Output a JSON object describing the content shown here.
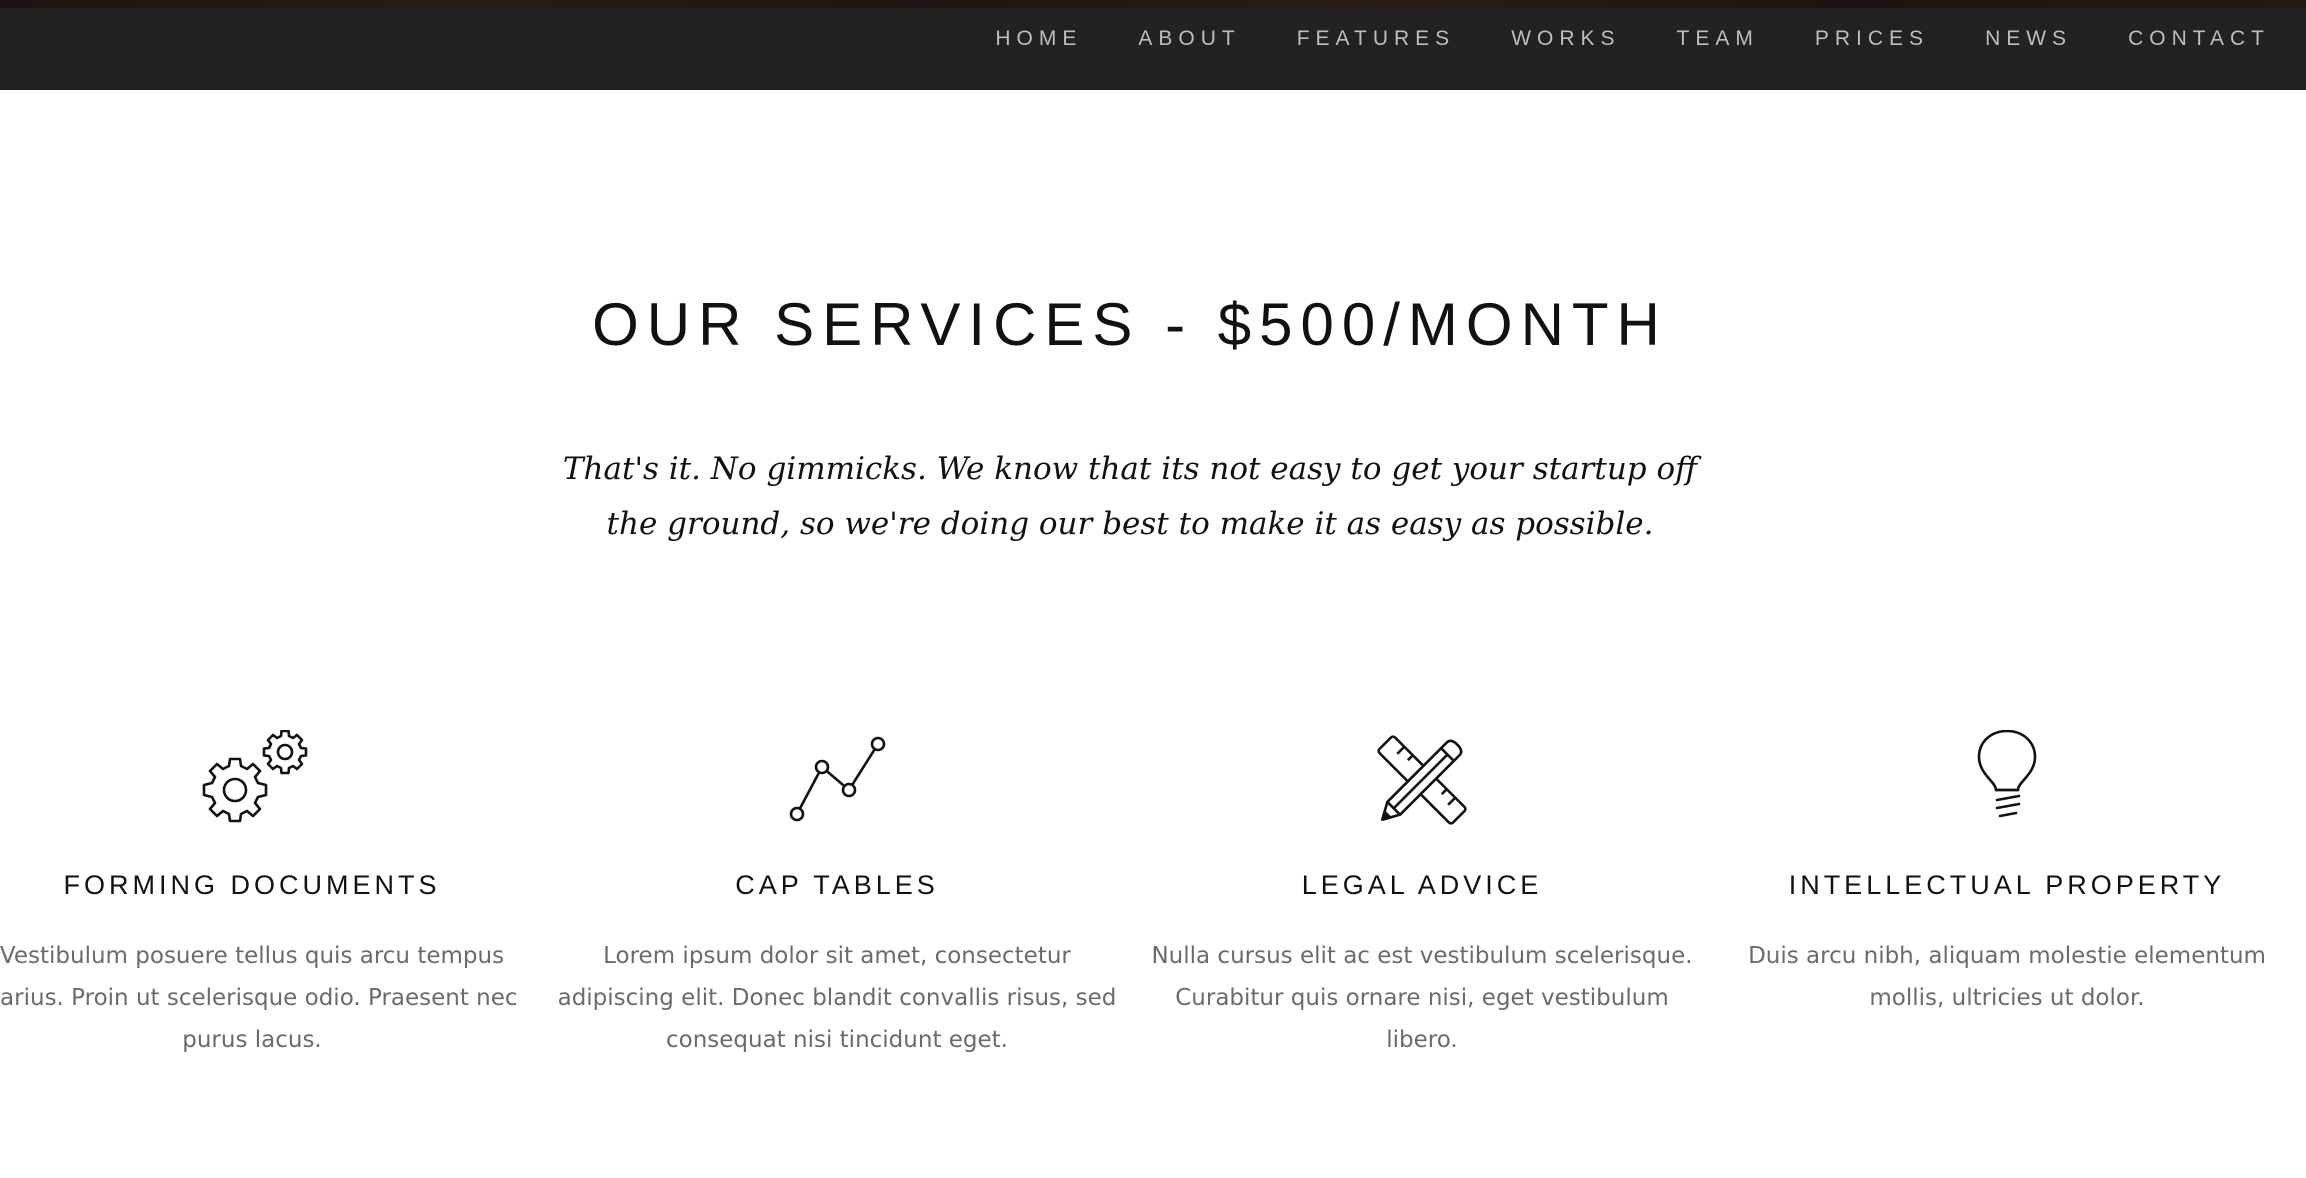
{
  "nav": {
    "items": [
      "HOME",
      "ABOUT",
      "FEATURES",
      "WORKS",
      "TEAM",
      "PRICES",
      "NEWS",
      "CONTACT"
    ]
  },
  "section": {
    "title": "OUR SERVICES - $500/MONTH",
    "subtitle": "That's it. No gimmicks. We know that its not easy to get your startup off the ground, so we're doing our best to make it as easy as possible."
  },
  "services": [
    {
      "icon": "gears-icon",
      "title": "FORMING DOCUMENTS",
      "text": "Vestibulum posuere tellus quis arcu tempus varius. Proin ut scelerisque odio. Praesent nec purus lacus."
    },
    {
      "icon": "line-chart-icon",
      "title": "CAP TABLES",
      "text": "Lorem ipsum dolor sit amet, consectetur adipiscing elit. Donec blandit convallis risus, sed consequat nisi tincidunt eget."
    },
    {
      "icon": "pencil-ruler-icon",
      "title": "LEGAL ADVICE",
      "text": "Nulla cursus elit ac est vestibulum scelerisque. Curabitur quis ornare nisi, eget vestibulum libero."
    },
    {
      "icon": "lightbulb-icon",
      "title": "INTELLECTUAL PROPERTY",
      "text": "Duis arcu nibh, aliquam molestie elementum mollis, ultricies ut dolor."
    }
  ],
  "colors": {
    "navbar": "#222222",
    "nav_text": "#bdbdbd",
    "heading": "#111111",
    "body_text": "#6b6b6b"
  }
}
